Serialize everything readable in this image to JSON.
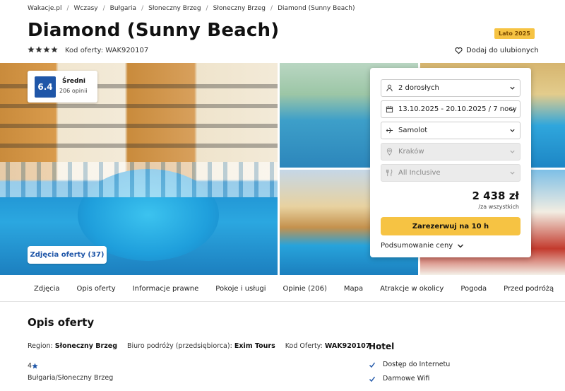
{
  "breadcrumb": [
    "Wakacje.pl",
    "Wczasy",
    "Bułgaria",
    "Słoneczny Brzeg",
    "Słoneczny Brzeg",
    "Diamond (Sunny Beach)"
  ],
  "hotel": {
    "title": "Diamond (Sunny Beach)",
    "season_badge": "Lato 2025",
    "stars": 4,
    "offer_code_label": "Kod oferty: WAK920107",
    "favorite_label": "Dodaj do ulubionych"
  },
  "rating": {
    "score": "6.4",
    "label": "Średni",
    "count": "206 opinii"
  },
  "gallery": {
    "photos_button": "Zdjęcia oferty (37)"
  },
  "booking": {
    "travelers": "2 dorosłych",
    "dates": "13.10.2025 - 20.10.2025 / 7 nocy",
    "transport": "Samolot",
    "departure": "Kraków",
    "board": "All Inclusive",
    "price": "2 438 zł",
    "price_note": "/za wszystkich",
    "reserve_button": "Zarezerwuj na 10 h",
    "summary_label": "Podsumowanie ceny"
  },
  "tabs": [
    "Zdjęcia",
    "Opis oferty",
    "Informacje prawne",
    "Pokoje i usługi",
    "Opinie (206)",
    "Mapa",
    "Atrakcje w okolicy",
    "Pogoda",
    "Przed podróżą"
  ],
  "description": {
    "title": "Opis oferty",
    "region_label": "Region:",
    "region_value": "Słoneczny Brzeg",
    "operator_label": "Biuro podróży (przedsiębiorca):",
    "operator_value": "Exim Tours",
    "code_label": "Kod Oferty:",
    "code_value": "WAK920107",
    "stars_value": "4",
    "location": "Bułgaria/Słoneczny Brzeg"
  },
  "amenities": {
    "heading": "Hotel",
    "items": [
      "Dostęp do Internetu",
      "Darmowe Wifi"
    ]
  },
  "colors": {
    "accent_yellow": "#f6c343",
    "brand_blue": "#1f56a8",
    "check_blue": "#1f56a8"
  }
}
